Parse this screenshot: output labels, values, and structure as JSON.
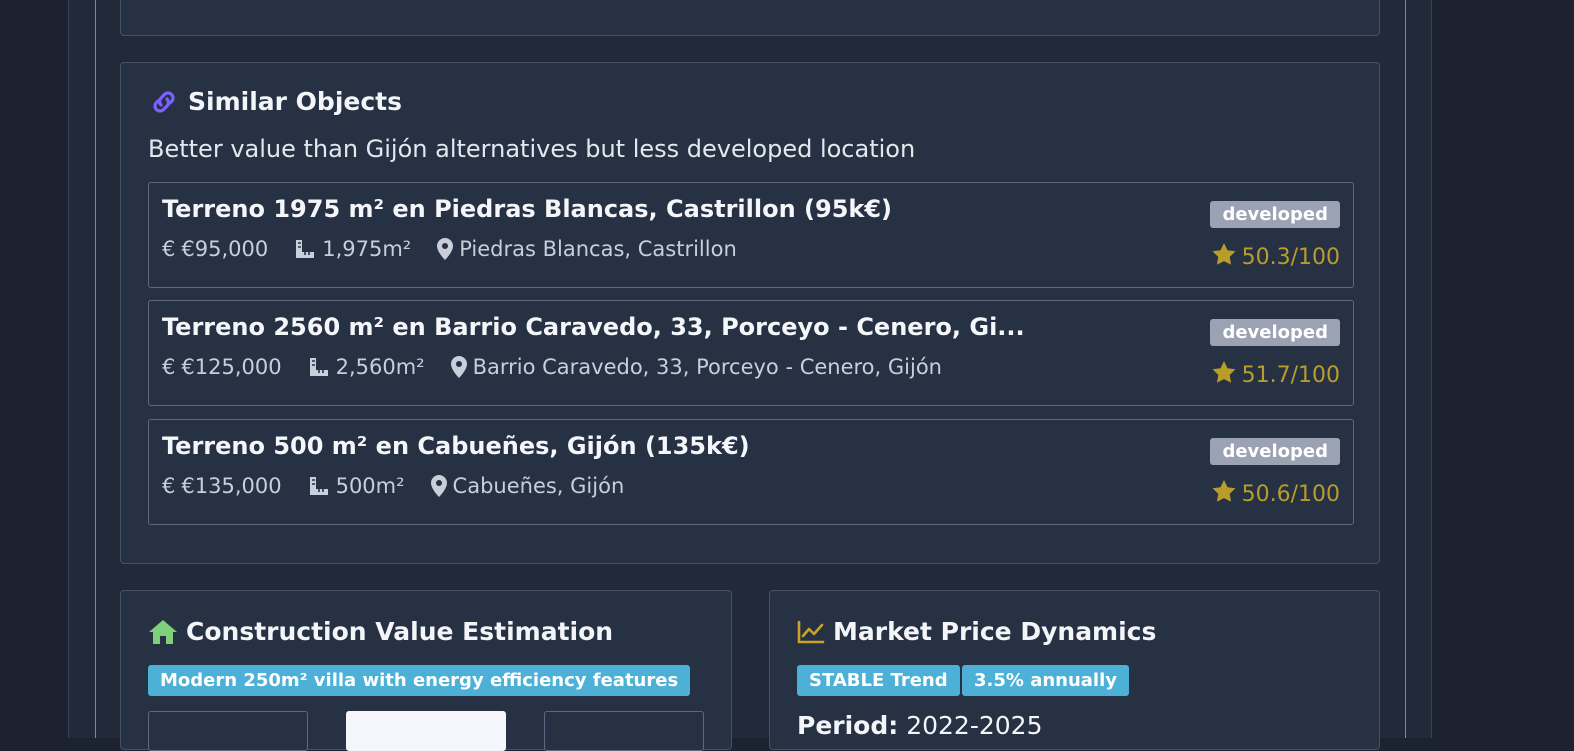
{
  "similar_objects": {
    "title": "Similar Objects",
    "description": "Better value than Gijón alternatives but less developed location",
    "items": [
      {
        "title": "Terreno 1975 m² en Piedras Blancas, Castrillon (95k€)",
        "price": "€95,000",
        "area": "1,975m²",
        "location": "Piedras Blancas, Castrillon",
        "badge": "developed",
        "score": "50.3/100"
      },
      {
        "title": "Terreno 2560 m² en Barrio Caravedo, 33, Porceyo - Cenero, Gi...",
        "price": "€125,000",
        "area": "2,560m²",
        "location": "Barrio Caravedo, 33, Porceyo - Cenero, Gijón",
        "badge": "developed",
        "score": "51.7/100"
      },
      {
        "title": "Terreno 500 m² en Cabueñes, Gijón (135k€)",
        "price": "€135,000",
        "area": "500m²",
        "location": "Cabueñes, Gijón",
        "badge": "developed",
        "score": "50.6/100"
      }
    ]
  },
  "construction": {
    "title": "Construction Value Estimation",
    "tag": "Modern 250m² villa with energy efficiency features"
  },
  "market": {
    "title": "Market Price Dynamics",
    "trend_tag": "STABLE Trend",
    "rate_tag": "3.5% annually",
    "period_label": "Period:",
    "period_value": "2022-2025"
  },
  "icons": {
    "currency": "euro-icon",
    "area": "ruler-icon",
    "location": "map-pin-icon",
    "score": "star-icon",
    "similar": "link-icon",
    "construction": "home-icon",
    "market": "chart-line-icon"
  },
  "colors": {
    "accent_link": "#7b61ff",
    "home_icon": "#7ed07a",
    "chart_icon": "#c9a227",
    "tag_bg": "#4db0d6",
    "badge_bg": "#9aa2b4",
    "score": "#b99d2a"
  }
}
